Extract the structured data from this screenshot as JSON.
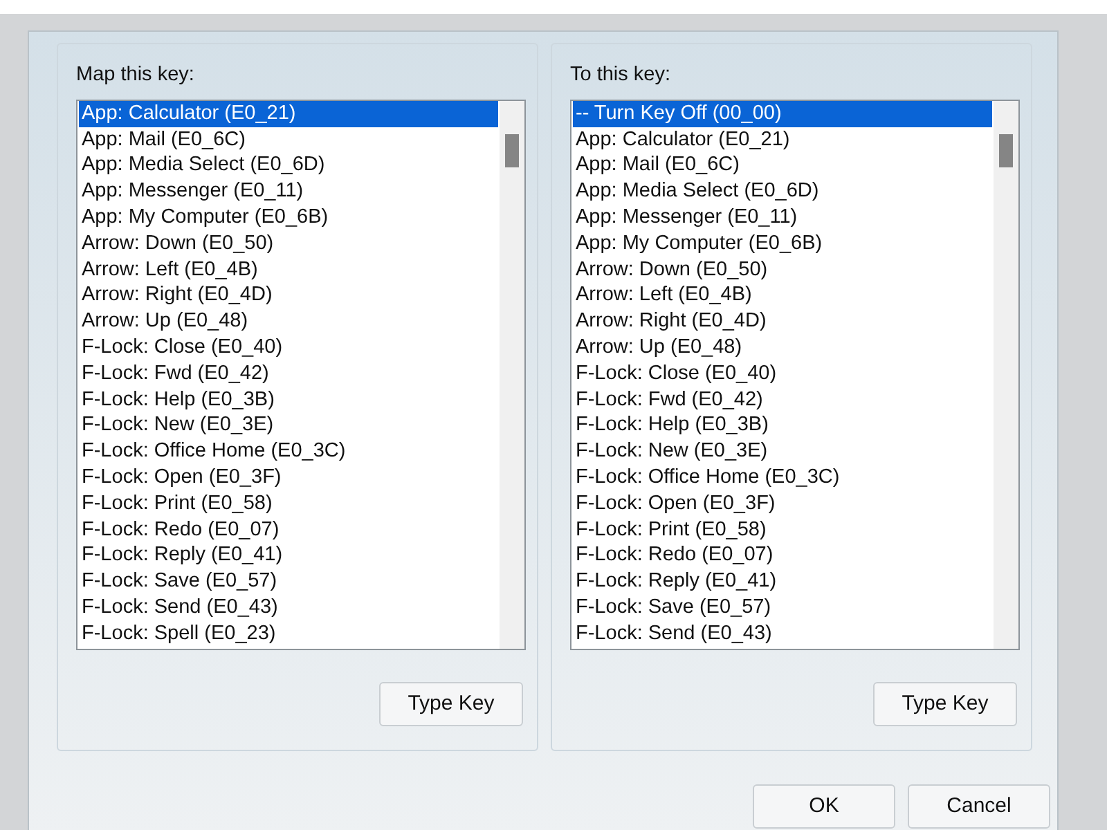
{
  "panels": [
    {
      "label": "Map this key:",
      "items": [
        {
          "text": "App: Calculator (E0_21)",
          "selected": true
        },
        {
          "text": "App: Mail (E0_6C)",
          "selected": false
        },
        {
          "text": "App: Media Select (E0_6D)",
          "selected": false
        },
        {
          "text": "App: Messenger (E0_11)",
          "selected": false
        },
        {
          "text": "App: My Computer (E0_6B)",
          "selected": false
        },
        {
          "text": "Arrow: Down (E0_50)",
          "selected": false
        },
        {
          "text": "Arrow: Left (E0_4B)",
          "selected": false
        },
        {
          "text": "Arrow: Right (E0_4D)",
          "selected": false
        },
        {
          "text": "Arrow: Up (E0_48)",
          "selected": false
        },
        {
          "text": "F-Lock: Close (E0_40)",
          "selected": false
        },
        {
          "text": "F-Lock: Fwd (E0_42)",
          "selected": false
        },
        {
          "text": "F-Lock: Help (E0_3B)",
          "selected": false
        },
        {
          "text": "F-Lock: New (E0_3E)",
          "selected": false
        },
        {
          "text": "F-Lock: Office Home (E0_3C)",
          "selected": false
        },
        {
          "text": "F-Lock: Open (E0_3F)",
          "selected": false
        },
        {
          "text": "F-Lock: Print (E0_58)",
          "selected": false
        },
        {
          "text": "F-Lock: Redo (E0_07)",
          "selected": false
        },
        {
          "text": "F-Lock: Reply (E0_41)",
          "selected": false
        },
        {
          "text": "F-Lock: Save (E0_57)",
          "selected": false
        },
        {
          "text": "F-Lock: Send (E0_43)",
          "selected": false
        },
        {
          "text": "F-Lock: Spell (E0_23)",
          "selected": false
        }
      ],
      "button": "Type Key"
    },
    {
      "label": "To this key:",
      "items": [
        {
          "text": "-- Turn Key Off (00_00)",
          "selected": true
        },
        {
          "text": "App: Calculator (E0_21)",
          "selected": false
        },
        {
          "text": "App: Mail (E0_6C)",
          "selected": false
        },
        {
          "text": "App: Media Select (E0_6D)",
          "selected": false
        },
        {
          "text": "App: Messenger (E0_11)",
          "selected": false
        },
        {
          "text": "App: My Computer (E0_6B)",
          "selected": false
        },
        {
          "text": "Arrow: Down (E0_50)",
          "selected": false
        },
        {
          "text": "Arrow: Left (E0_4B)",
          "selected": false
        },
        {
          "text": "Arrow: Right (E0_4D)",
          "selected": false
        },
        {
          "text": "Arrow: Up (E0_48)",
          "selected": false
        },
        {
          "text": "F-Lock: Close (E0_40)",
          "selected": false
        },
        {
          "text": "F-Lock: Fwd (E0_42)",
          "selected": false
        },
        {
          "text": "F-Lock: Help (E0_3B)",
          "selected": false
        },
        {
          "text": "F-Lock: New (E0_3E)",
          "selected": false
        },
        {
          "text": "F-Lock: Office Home (E0_3C)",
          "selected": false
        },
        {
          "text": "F-Lock: Open (E0_3F)",
          "selected": false
        },
        {
          "text": "F-Lock: Print (E0_58)",
          "selected": false
        },
        {
          "text": "F-Lock: Redo (E0_07)",
          "selected": false
        },
        {
          "text": "F-Lock: Reply (E0_41)",
          "selected": false
        },
        {
          "text": "F-Lock: Save (E0_57)",
          "selected": false
        },
        {
          "text": "F-Lock: Send (E0_43)",
          "selected": false
        }
      ],
      "button": "Type Key"
    }
  ],
  "buttons": [
    "OK",
    "Cancel"
  ]
}
